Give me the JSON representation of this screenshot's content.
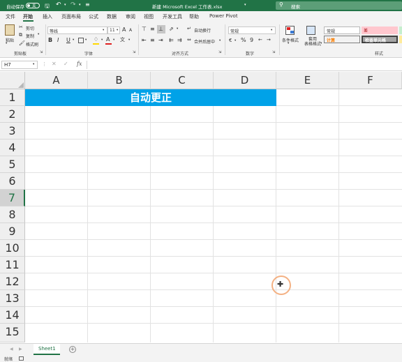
{
  "titlebar": {
    "autosave_label": "自动保存",
    "autosave_state": "关",
    "title": "新建 Microsoft Excel 工作表.xlsx",
    "search_placeholder": "搜索"
  },
  "tabs": [
    "文件",
    "开始",
    "插入",
    "页面布局",
    "公式",
    "数据",
    "审阅",
    "视图",
    "开发工具",
    "帮助",
    "Power Pivot"
  ],
  "active_tab": "开始",
  "ribbon": {
    "clipboard": {
      "paste": "粘贴",
      "cut": "剪切",
      "copy": "复制",
      "format_painter": "格式刷",
      "label": "剪贴板"
    },
    "font": {
      "name": "等线",
      "size": "11",
      "label": "字体",
      "bold": "B",
      "italic": "I",
      "underline": "U",
      "grow": "A",
      "shrink": "A",
      "color_letter": "A"
    },
    "alignment": {
      "wrap": "自动换行",
      "merge": "合并后居中",
      "label": "对齐方式"
    },
    "number": {
      "format": "常规",
      "percent": "%",
      "comma": "9",
      "label": "数字"
    },
    "styles": {
      "conditional": "条件格式",
      "table": "套用\n表格格式",
      "normal": "常规",
      "bad": "差",
      "calc": "计算",
      "check": "检查单元格",
      "label": "样式"
    }
  },
  "formula_bar": {
    "name_box": "H7",
    "fx": "fx",
    "value": ""
  },
  "columns": [
    "A",
    "B",
    "C",
    "D",
    "E",
    "F"
  ],
  "rows": [
    "1",
    "2",
    "3",
    "4",
    "5",
    "6",
    "7",
    "8",
    "9",
    "10",
    "11",
    "12",
    "13",
    "14",
    "15"
  ],
  "selected_row": "7",
  "cells": {
    "merged_A1_D1": "自动更正"
  },
  "merged_fill": "#00a2e8",
  "sheets": [
    "Sheet1"
  ],
  "add_sheet": "+",
  "status": {
    "ready": "就绪"
  }
}
